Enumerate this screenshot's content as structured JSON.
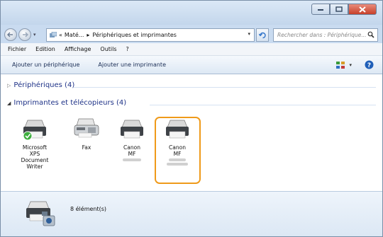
{
  "address": {
    "path_prefix": "«",
    "crumb1": "Maté...",
    "sep": "▸",
    "crumb2": "Périphériques et imprimantes"
  },
  "search": {
    "placeholder": "Rechercher dans : Périphérique..."
  },
  "menu": [
    "Fichier",
    "Edition",
    "Affichage",
    "Outils",
    "?"
  ],
  "toolbar": {
    "add_device": "Ajouter un périphérique",
    "add_printer": "Ajouter une imprimante"
  },
  "groups": {
    "devices": "Périphériques (4)",
    "printers": "Imprimantes et télécopieurs (4)"
  },
  "items": [
    {
      "label_lines": [
        "Microsoft",
        "XPS",
        "Document",
        "Writer"
      ],
      "default": true,
      "selected": false
    },
    {
      "label_lines": [
        "Fax"
      ],
      "default": false,
      "selected": false
    },
    {
      "label_lines": [
        "Canon",
        "MF"
      ],
      "default": false,
      "selected": false
    },
    {
      "label_lines": [
        "Canon",
        "MF"
      ],
      "default": false,
      "selected": true
    }
  ],
  "status": {
    "count": "8 élément(s)"
  },
  "colors": {
    "selection": "#ef9a1a",
    "group_text": "#1e3287",
    "close_button": "#c7402a"
  }
}
